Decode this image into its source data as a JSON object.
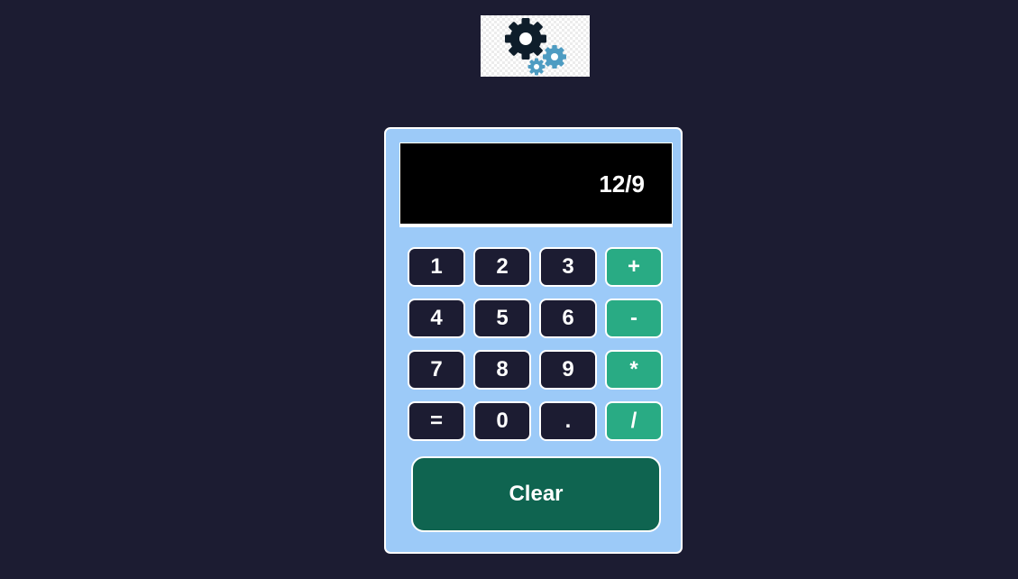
{
  "logo": {
    "icon": "gears-icon",
    "colors": {
      "large_gear": "#0e1d2a",
      "small_gears": "#4e9cc2"
    }
  },
  "display": {
    "value": "12/9"
  },
  "keys": [
    {
      "label": "1",
      "kind": "number"
    },
    {
      "label": "2",
      "kind": "number"
    },
    {
      "label": "3",
      "kind": "number"
    },
    {
      "label": "+",
      "kind": "operator"
    },
    {
      "label": "4",
      "kind": "number"
    },
    {
      "label": "5",
      "kind": "number"
    },
    {
      "label": "6",
      "kind": "number"
    },
    {
      "label": "-",
      "kind": "operator"
    },
    {
      "label": "7",
      "kind": "number"
    },
    {
      "label": "8",
      "kind": "number"
    },
    {
      "label": "9",
      "kind": "number"
    },
    {
      "label": "*",
      "kind": "operator"
    },
    {
      "label": "=",
      "kind": "number"
    },
    {
      "label": "0",
      "kind": "number"
    },
    {
      "label": ".",
      "kind": "number"
    },
    {
      "label": "/",
      "kind": "operator"
    }
  ],
  "clear_label": "Clear",
  "colors": {
    "page_background": "#1c1c32",
    "calculator_body": "#9ccaf8",
    "display_background": "#000000",
    "number_key": "#1c1c32",
    "operator_key": "#29ab84",
    "clear_button": "#0f6450"
  }
}
